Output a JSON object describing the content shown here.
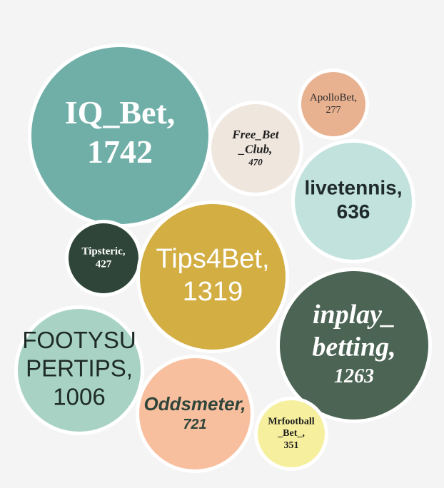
{
  "chart_data": {
    "type": "bubble",
    "bubbles": [
      {
        "label": "IQ_Bet,",
        "value": "1742",
        "count": 1742,
        "fill": "#6fafa7",
        "text": "#ffffff"
      },
      {
        "label": "Free_Bet_Club,",
        "value": "470",
        "count": 470,
        "fill": "#efe6de",
        "text": "#1e1e1e"
      },
      {
        "label": "ApolloBet,",
        "value": "277",
        "count": 277,
        "fill": "#e8b190",
        "text": "#2b2b2b"
      },
      {
        "label": "livetennis,",
        "value": "636",
        "count": 636,
        "fill": "#c2e2de",
        "text": "#1f2a2a"
      },
      {
        "label": "Tipsteric,",
        "value": "427",
        "count": 427,
        "fill": "#2f4539",
        "text": "#ffffff"
      },
      {
        "label": "Tips4Bet,",
        "value": "1319",
        "count": 1319,
        "fill": "#d3ae43",
        "text": "#ffffff"
      },
      {
        "label": "inplay_betting,",
        "value": "1263",
        "count": 1263,
        "fill": "#4b6453",
        "text": "#ffffff"
      },
      {
        "label": "FOOTYSUPERTIPS,",
        "value": "1006",
        "count": 1006,
        "fill": "#a8d3c4",
        "text": "#1e2a26"
      },
      {
        "label": "Oddsmeter,",
        "value": "721",
        "count": 721,
        "fill": "#f8bf9f",
        "text": "#2f4539"
      },
      {
        "label": "Mrfootball_Bet_,",
        "value": "351",
        "count": 351,
        "fill": "#f6ef9e",
        "text": "#1e1e1e"
      }
    ]
  }
}
